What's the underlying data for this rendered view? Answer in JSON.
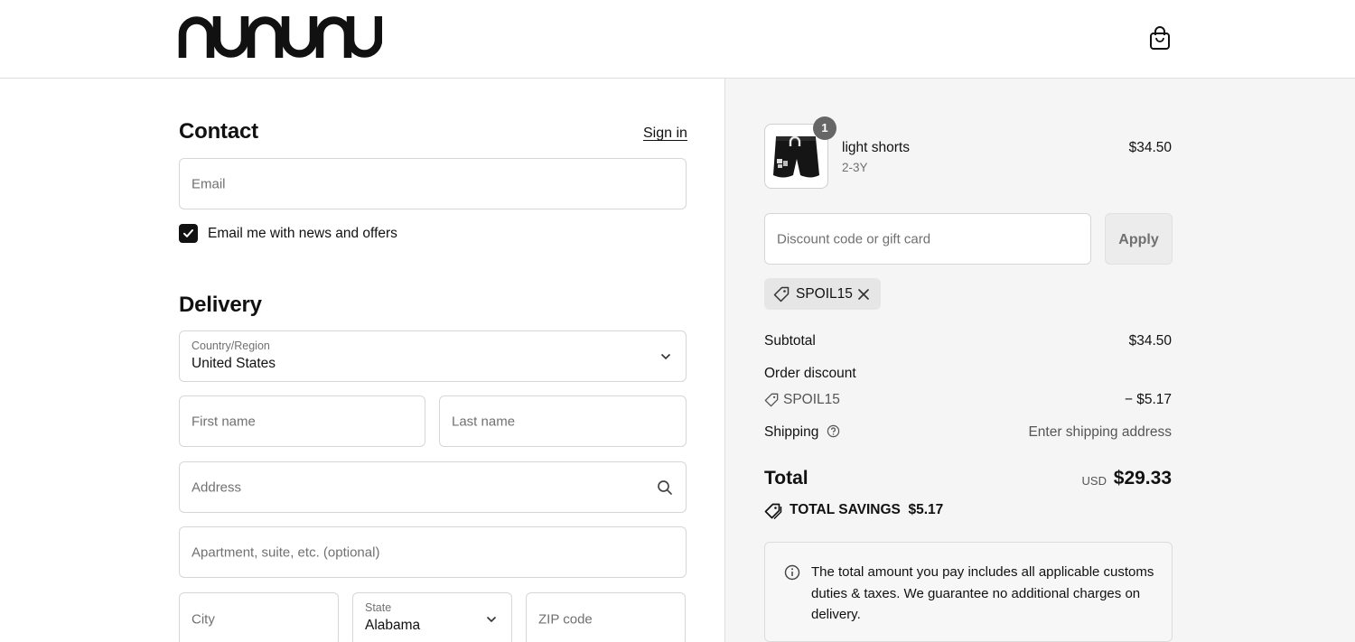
{
  "brand": {
    "name": "nununu"
  },
  "contact": {
    "heading": "Contact",
    "sign_in": "Sign in",
    "email_placeholder": "Email",
    "newsletter_label": "Email me with news and offers"
  },
  "delivery": {
    "heading": "Delivery",
    "country_label": "Country/Region",
    "country_value": "United States",
    "first_name_placeholder": "First name",
    "last_name_placeholder": "Last name",
    "address_placeholder": "Address",
    "apartment_placeholder": "Apartment, suite, etc. (optional)",
    "city_placeholder": "City",
    "state_label": "State",
    "state_value": "Alabama",
    "zip_placeholder": "ZIP code"
  },
  "order": {
    "item": {
      "name": "light shorts",
      "variant": "2-3Y",
      "price": "$34.50",
      "quantity": "1"
    },
    "discount_placeholder": "Discount code or gift card",
    "apply_label": "Apply",
    "applied_code": "SPOIL15",
    "subtotal_label": "Subtotal",
    "subtotal_value": "$34.50",
    "order_discount_label": "Order discount",
    "discount_code": "SPOIL15",
    "discount_value": "− $5.17",
    "shipping_label": "Shipping",
    "shipping_value": "Enter shipping address",
    "total_label": "Total",
    "currency": "USD",
    "total_value": "$29.33",
    "savings_label": "TOTAL SAVINGS",
    "savings_value": "$5.17",
    "notice": "The total amount you pay includes all applicable customs duties & taxes. We guarantee no additional charges on delivery."
  }
}
